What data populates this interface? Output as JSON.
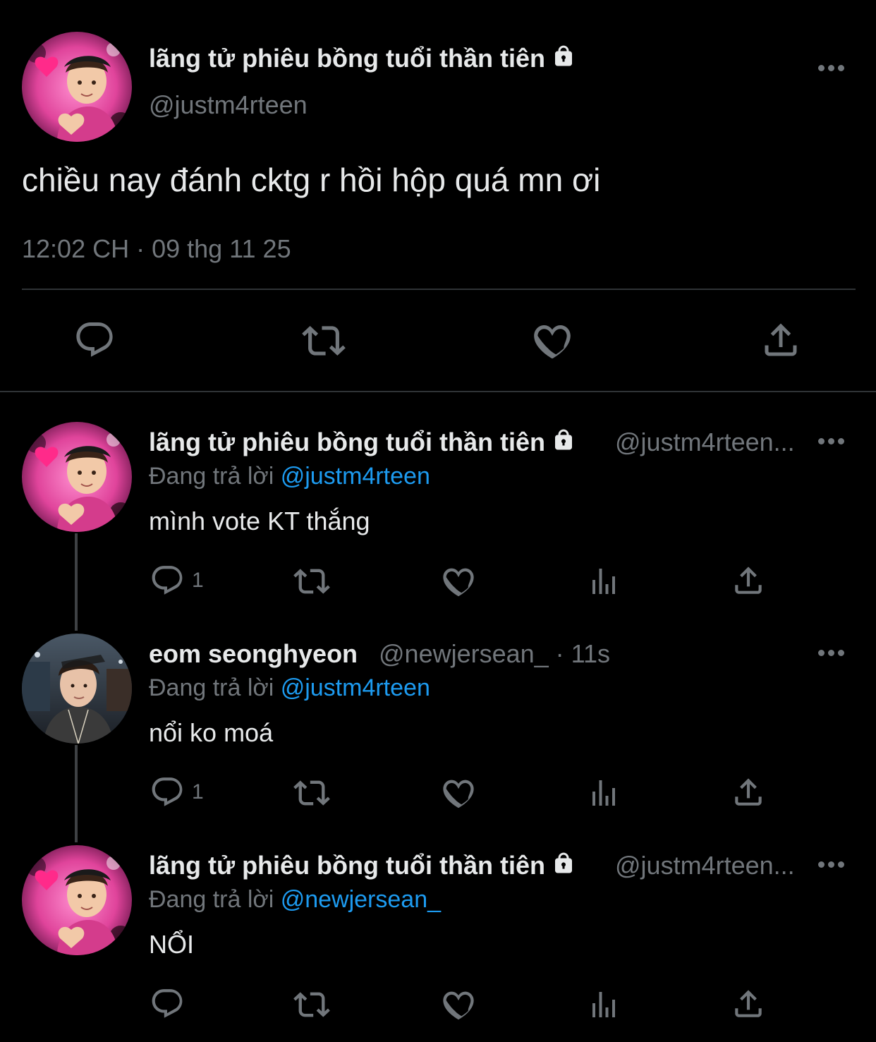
{
  "main_tweet": {
    "display_name": "lãng tử phiêu bồng tuổi thần tiên",
    "handle": "@justm4rteen",
    "text": "chiều nay đánh cktg r hồi hộp quá mn ơi",
    "timestamp": "12:02 CH · 09 thg 11 25"
  },
  "replies": [
    {
      "display_name": "lãng tử phiêu bồng tuổi thần tiên",
      "handle": "@justm4rteen...",
      "replying_prefix": "Đang trả lời ",
      "replying_to": "@justm4rteen",
      "text": "mình vote KT thắng",
      "reply_count": "1"
    },
    {
      "display_name": "eom seonghyeon",
      "handle": "@newjersean_ · 11s",
      "replying_prefix": "Đang trả lời ",
      "replying_to": "@justm4rteen",
      "text": "nổi ko moá",
      "reply_count": "1"
    },
    {
      "display_name": "lãng tử phiêu bồng tuổi thần tiên",
      "handle": "@justm4rteen...",
      "replying_prefix": "Đang trả lời ",
      "replying_to": "@newjersean_",
      "text": "NỔI",
      "reply_count": ""
    }
  ],
  "colors": {
    "background": "#000000",
    "text_primary": "#e7e9ea",
    "text_secondary": "#71767b",
    "link": "#1d9bf0",
    "divider": "#2f3336",
    "avatar_pink": "#e0449b"
  },
  "icons": [
    "lock-icon",
    "more-icon",
    "reply-icon",
    "retweet-icon",
    "like-icon",
    "share-icon",
    "views-icon"
  ]
}
